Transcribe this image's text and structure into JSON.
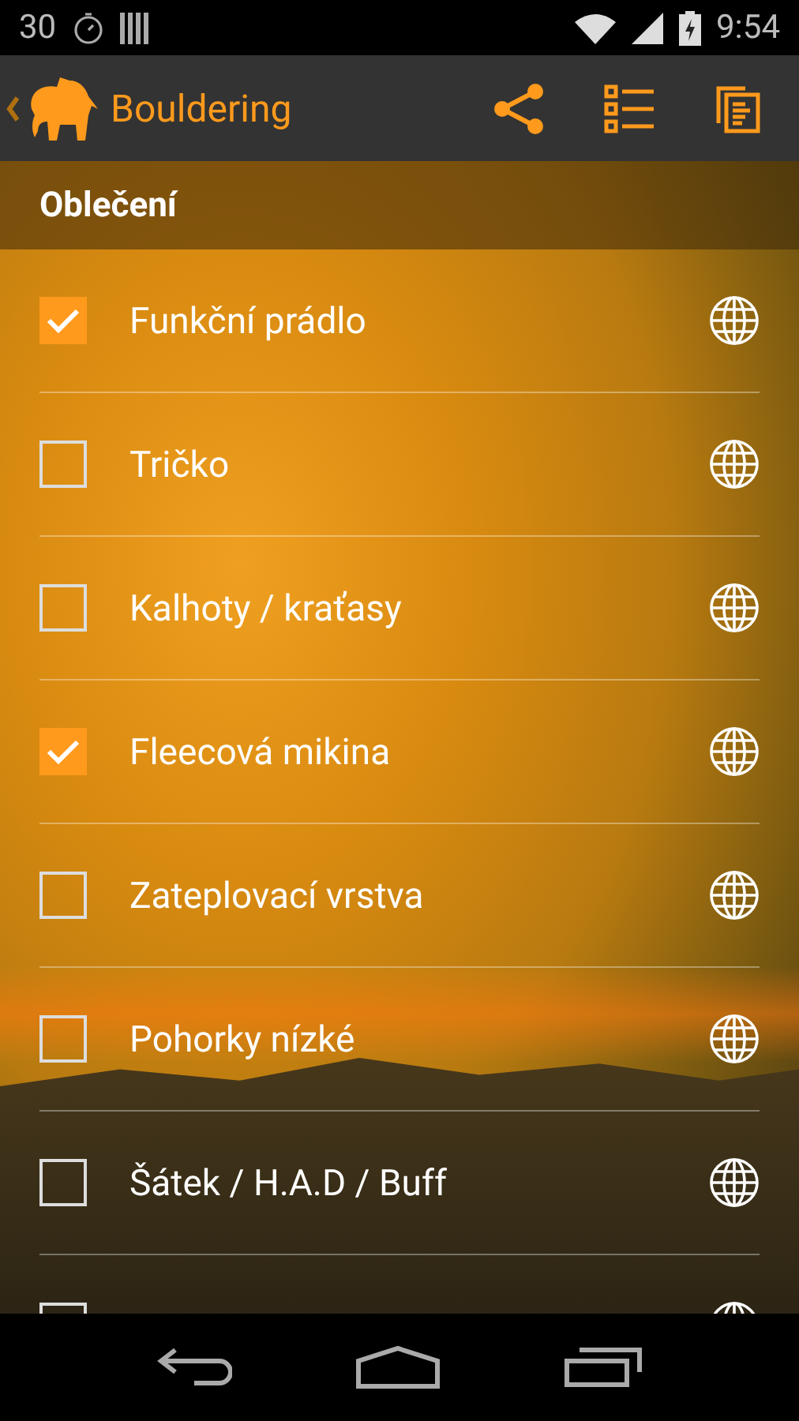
{
  "status_bar": {
    "notification_count": "30",
    "time": "9:54"
  },
  "app_bar": {
    "title": "Bouldering"
  },
  "section": {
    "title": "Oblečení"
  },
  "items": [
    {
      "label": "Funkční prádlo",
      "checked": true
    },
    {
      "label": "Tričko",
      "checked": false
    },
    {
      "label": "Kalhoty / kraťasy",
      "checked": false
    },
    {
      "label": "Fleecová mikina",
      "checked": true
    },
    {
      "label": "Zateplovací vrstva",
      "checked": false
    },
    {
      "label": "Pohorky nízké",
      "checked": false
    },
    {
      "label": "Šátek / H.A.D / Buff",
      "checked": false
    },
    {
      "checked": false
    }
  ]
}
